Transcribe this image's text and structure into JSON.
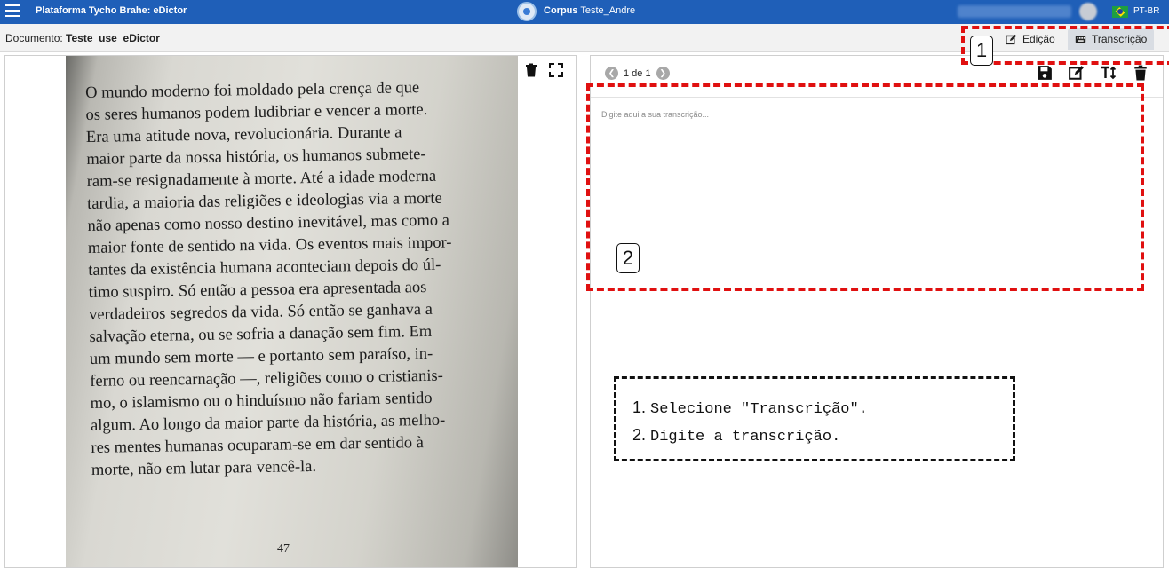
{
  "topbar": {
    "app_title": "Plataforma Tycho Brahe: eDictor",
    "corpus_label": "Corpus",
    "corpus_name": "Teste_Andre",
    "language": "PT-BR"
  },
  "docbar": {
    "label": "Documento:",
    "document_name": "Teste_use_eDictor",
    "tabs": [
      {
        "label": "Edição",
        "icon": "edit-icon"
      },
      {
        "label": "Transcrição",
        "icon": "keyboard-icon",
        "active": true
      }
    ]
  },
  "image_panel": {
    "book_lines": [
      "O mundo moderno foi moldado pela crença de que",
      "os seres humanos podem ludibriar e vencer a morte.",
      "Era uma atitude nova, revolucionária. Durante a",
      "maior parte da nossa história, os humanos submete-",
      "ram-se resignadamente à morte. Até a idade moderna",
      "tardia, a maioria das religiões e ideologias via a morte",
      "não apenas como nosso destino inevitável, mas como a",
      "maior fonte de sentido na vida. Os eventos mais impor-",
      "tantes da existência humana aconteciam depois do úl-",
      "timo suspiro. Só então a pessoa era apresentada aos",
      "verdadeiros segredos da vida. Só então se ganhava a",
      "salvação eterna, ou se sofria a danação sem fim. Em",
      "um mundo sem morte — e portanto sem paraíso, in-",
      "ferno ou reencarnação —, religiões como o cristianis-",
      "mo, o islamismo ou o hinduísmo não fariam sentido",
      "algum. Ao longo da maior parte da história, as melho-",
      "res mentes humanas ocuparam-se em dar sentido à",
      "morte, não em lutar para vencê-la."
    ],
    "page_number": "47"
  },
  "transcription_panel": {
    "pager_text": "1 de 1",
    "placeholder": "Digite aqui a sua transcrição...",
    "value": ""
  },
  "annotations": {
    "badge1": "1",
    "badge2": "2",
    "steps": [
      {
        "num": "1.",
        "text": "Selecione \"Transcrição\"."
      },
      {
        "num": "2.",
        "text": "Digite a transcrição."
      }
    ],
    "highlight_color": "#e01010"
  },
  "colors": {
    "topbar": "#1f5fb8",
    "active_tab": "#d9dde3"
  }
}
